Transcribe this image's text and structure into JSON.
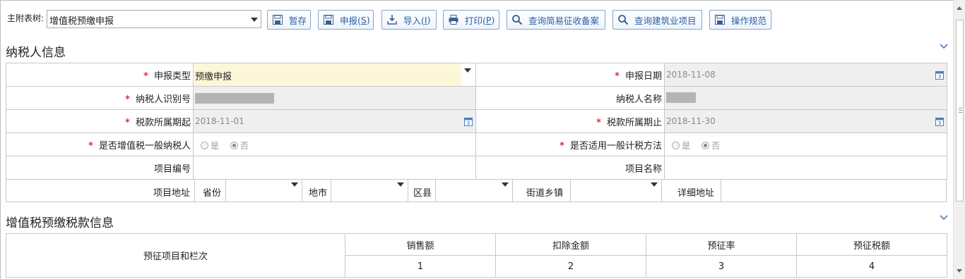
{
  "toolbar": {
    "tree_label": "主附表树:",
    "tree_value": "增值税预缴申报",
    "buttons": {
      "save": "暂存",
      "declare": "申报(",
      "declare_key": "S",
      "import": "导入(",
      "import_key": "I",
      "print": "打印(",
      "print_key": "P",
      "close_paren": ")",
      "query_simple": "查询简易征收备案",
      "query_building": "查询建筑业项目",
      "guide": "操作规范"
    }
  },
  "taxpayer": {
    "title": "纳税人信息",
    "required_mark": "*",
    "declare_type_label": "申报类型",
    "declare_type_value": "预缴申报",
    "declare_date_label": "申报日期",
    "declare_date_value": "2018-11-08",
    "taxpayer_id_label": "纳税人识别号",
    "taxpayer_name_label": "纳税人名称",
    "period_start_label": "税款所属期起",
    "period_start_value": "2018-11-01",
    "period_end_label": "税款所属期止",
    "period_end_value": "2018-11-30",
    "general_taxpayer_label": "是否增值税一般纳税人",
    "general_method_label": "是否适用一般计税方法",
    "yes": "是",
    "no": "否",
    "project_no_label": "项目编号",
    "project_name_label": "项目名称",
    "project_addr_label": "项目地址",
    "province_label": "省份",
    "city_label": "地市",
    "county_label": "区县",
    "street_label": "街道乡镇",
    "detail_addr_label": "详细地址"
  },
  "tax_info": {
    "title": "增值税预缴税款信息",
    "item_col_label": "预征项目和栏次",
    "columns": [
      "销售额",
      "扣除金额",
      "预征率",
      "预征税额"
    ],
    "column_numbers": [
      "1",
      "2",
      "3",
      "4"
    ]
  },
  "colors": {
    "accent": "#2b5fa8",
    "required": "#e03030",
    "highlight_bg": "#fdf7d9",
    "readonly_bg": "#efefef"
  }
}
